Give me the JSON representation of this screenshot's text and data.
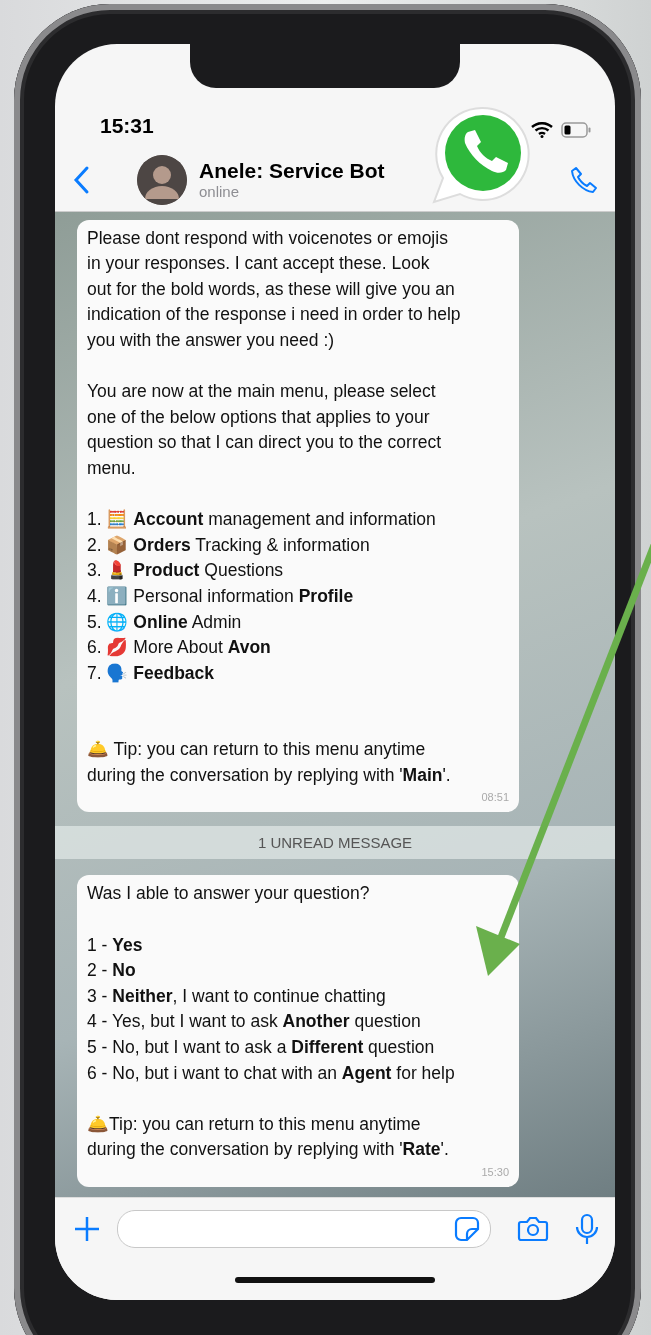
{
  "status_bar": {
    "time": "15:31"
  },
  "header": {
    "name": "Anele: Service Bot",
    "status": "online"
  },
  "chat": [
    {
      "kind": "message",
      "time": "08:51",
      "paragraphs": [
        {
          "kind": "text",
          "lines": [
            "Please dont respond with voicenotes or emojis",
            "in your responses.  I cant accept these.  Look",
            "out for the bold words, as these will give you an",
            "indication of the response i need in order to help",
            "you with the answer you need :)"
          ]
        },
        {
          "kind": "text",
          "lines": [
            "You are now at the main menu, please select",
            "one of the below options that applies to your",
            "question so that I can direct you to the correct",
            "menu."
          ]
        },
        {
          "kind": "list",
          "lines": [
            "1. 🧮  **Account** management and information",
            "2. 📦 **Orders** Tracking & information",
            "3. 💄  **Product** Questions",
            "4. ℹ️ Personal information **Profile**",
            "5. 🌐 **Online** Admin",
            "6. 💋 More About **Avon**",
            "7. 🗣️ **Feedback**"
          ]
        },
        {
          "kind": "tip",
          "lines": [
            "🛎️ Tip: you can return to this menu anytime",
            "during the conversation by replying with '**Main**'."
          ]
        }
      ]
    },
    {
      "kind": "banner",
      "text": "1 UNREAD MESSAGE"
    },
    {
      "kind": "message",
      "time": "15:30",
      "paragraphs": [
        {
          "kind": "text",
          "lines": [
            "Was I able to answer your question?"
          ]
        },
        {
          "kind": "list",
          "lines": [
            "1 - **Yes**",
            "2 - **No**",
            "3 - **Neither**, I want to continue chatting",
            "4 - Yes, but I want to ask **Another** question",
            "5 - No, but I want to ask a **Different** question",
            "6 - No, but i want to chat with an **Agent** for help"
          ]
        },
        {
          "kind": "text",
          "lines": [
            "🛎️Tip: you can return to this menu anytime",
            "during the conversation by replying with '**Rate**'."
          ]
        }
      ]
    }
  ]
}
